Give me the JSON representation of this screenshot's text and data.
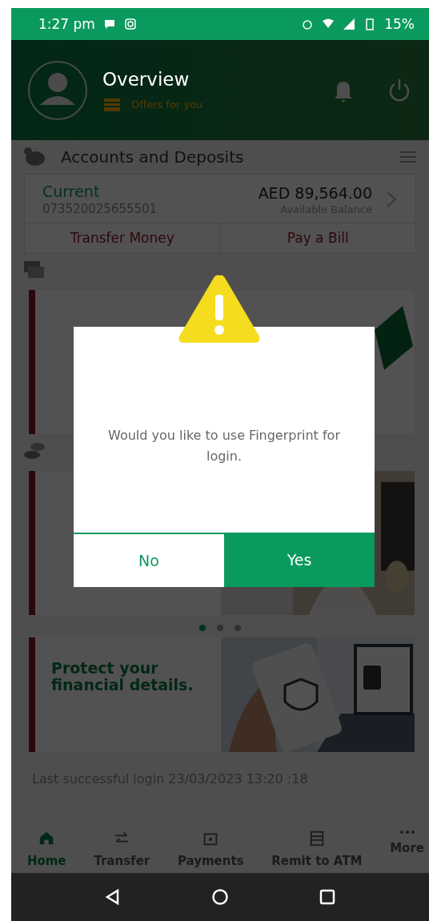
{
  "status_bar": {
    "time": "1:27 pm",
    "battery": "15%"
  },
  "header": {
    "title": "Overview",
    "offers": "Offers for you"
  },
  "accounts": {
    "title": "Accounts and Deposits",
    "type": "Current",
    "number": "073520025655501",
    "balance": "AED 89,564.00",
    "balance_label": "Available Balance",
    "actions": [
      "Transfer Money",
      "Pay a Bill"
    ]
  },
  "carousel": {
    "dots": [
      {
        "selected": true
      },
      {
        "selected": false
      },
      {
        "selected": false
      }
    ]
  },
  "promo": {
    "title": "Protect your financial details."
  },
  "last_login": "Last successful login  23/03/2023 13:20 :18",
  "bottom_nav": [
    {
      "label": "Home",
      "selected": true
    },
    {
      "label": "Transfer",
      "selected": false
    },
    {
      "label": "Payments",
      "selected": false
    },
    {
      "label": "Remit to ATM",
      "selected": false
    },
    {
      "label": "More",
      "selected": false
    }
  ],
  "dialog": {
    "message": "Would you like to use Fingerprint for login.",
    "buttons": [
      {
        "label": "No",
        "kind": "secondary"
      },
      {
        "label": "Yes",
        "kind": "primary"
      }
    ]
  }
}
